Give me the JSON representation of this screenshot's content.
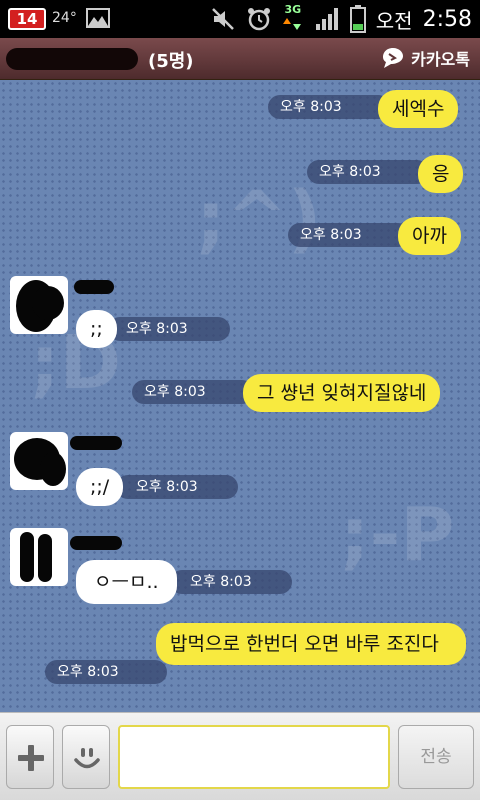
{
  "status_bar": {
    "notification_count": "14",
    "temperature": "24°",
    "network": "3G",
    "ampm": "오전",
    "time": "2:58"
  },
  "header": {
    "member_count": "(5명)",
    "brand": "카카오톡"
  },
  "watermarks": [
    ";^)",
    ";D",
    ";-P"
  ],
  "messages": [
    {
      "sender": "me",
      "text": "세엑수",
      "time": "오후 8:03"
    },
    {
      "sender": "me",
      "text": "응",
      "time": "오후 8:03"
    },
    {
      "sender": "me",
      "text": "아까",
      "time": "오후 8:03"
    },
    {
      "sender": "other",
      "text": ";;",
      "time": "오후 8:03"
    },
    {
      "sender": "me",
      "text": "그 썅년 잊혀지질않네",
      "time": "오후 8:03"
    },
    {
      "sender": "other",
      "text": ";;/",
      "time": "오후 8:03"
    },
    {
      "sender": "other",
      "text": "ㅇㅡㅁ..",
      "time": "오후 8:03"
    },
    {
      "sender": "me",
      "text": "밥먹으로 한번더 오면 바루 조진다",
      "time": "오후 8:03"
    }
  ],
  "input_bar": {
    "send_label": "전송",
    "input_value": "",
    "icons": [
      "plus-icon",
      "emoticon-icon"
    ]
  },
  "colors": {
    "my_bubble": "#f8ea3f",
    "other_bubble": "#ffffff",
    "chat_background": "#6a86b3",
    "header": "#5e3537"
  }
}
